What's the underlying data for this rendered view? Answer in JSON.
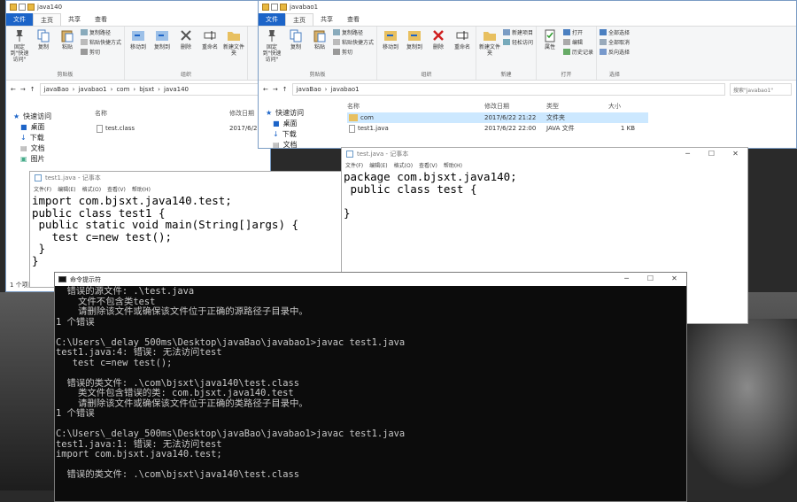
{
  "explorer1": {
    "title": "java140",
    "tabs": [
      "文件",
      "主页",
      "共享",
      "查看"
    ],
    "ribbon": {
      "pin_label": "固定到\"快速访问\"",
      "copy_label": "复制",
      "paste_label": "粘贴",
      "copy_path": "复制路径",
      "paste_shortcut": "粘贴快捷方式",
      "cut": "剪切",
      "clipboard_group": "剪贴板",
      "move_to": "移动到",
      "copy_to": "复制到",
      "delete": "删除",
      "rename": "重命名",
      "new_folder": "新建文件夹",
      "organize_group": "组织"
    },
    "path": [
      "javaBao",
      "javabao1",
      "com",
      "bjsxt",
      "java140"
    ],
    "nav": [
      "快速访问",
      "桌面",
      "下载",
      "文档",
      "图片"
    ],
    "col_name": "名称",
    "col_date": "修改日期",
    "files": [
      {
        "name": "test.class",
        "date": "2017/6/2"
      }
    ],
    "status": "1 个项目"
  },
  "explorer2": {
    "title": "javabao1",
    "tabs": [
      "文件",
      "主页",
      "共享",
      "查看"
    ],
    "ribbon": {
      "pin_label": "固定到\"快速访问\"",
      "copy_label": "复制",
      "paste_label": "粘贴",
      "copy_path": "复制路径",
      "paste_shortcut": "粘贴快捷方式",
      "cut": "剪切",
      "clipboard_group": "剪贴板",
      "move_to": "移动到",
      "copy_to": "复制到",
      "delete": "删除",
      "rename": "重命名",
      "organize_group": "组织",
      "new_item": "新建项目",
      "easy_access": "轻松访问",
      "new_folder": "新建文件夹",
      "new_group": "新建",
      "properties": "属性",
      "open": "打开",
      "edit": "编辑",
      "history": "历史记录",
      "open_group": "打开",
      "select_all": "全部选择",
      "select_none": "全部取消",
      "invert": "反向选择",
      "select_group": "选择"
    },
    "path": [
      "javaBao",
      "javabao1"
    ],
    "search_placeholder": "搜索\"javabao1\"",
    "nav": [
      "快速访问",
      "桌面",
      "下载",
      "文档",
      "图片"
    ],
    "col_name": "名称",
    "col_date": "修改日期",
    "col_type": "类型",
    "col_size": "大小",
    "files": [
      {
        "name": "com",
        "date": "2017/6/22 21:22",
        "type": "文件夹",
        "size": ""
      },
      {
        "name": "test1.java",
        "date": "2017/6/22 22:00",
        "type": "JAVA 文件",
        "size": "1 KB"
      }
    ]
  },
  "notepad1": {
    "title": "test1.java - 记事本",
    "menu": [
      "文件(F)",
      "编辑(E)",
      "格式(O)",
      "查看(V)",
      "帮助(H)"
    ],
    "content": "import com.bjsxt.java140.test;\npublic class test1 {\n public static void main(String[]args) {\n   test c=new test();\n }\n}"
  },
  "notepad2": {
    "title": "test.java - 记事本",
    "menu": [
      "文件(F)",
      "编辑(E)",
      "格式(O)",
      "查看(V)",
      "帮助(H)"
    ],
    "content": "package com.bjsxt.java140;\n public class test {\n\n}"
  },
  "cmd": {
    "title": "命令提示符",
    "content": "  错误的源文件: .\\test.java\n    文件不包含类test\n    请删除该文件或确保该文件位于正确的源路径子目录中。\n1 个错误\n\nC:\\Users\\_delay_500ms\\Desktop\\javaBao\\javabao1>javac test1.java\ntest1.java:4: 错误: 无法访问test\n   test c=new test();\n\n  错误的类文件: .\\com\\bjsxt\\java140\\test.class\n    类文件包含错误的类: com.bjsxt.java140.test\n    请删除该文件或确保该文件位于正确的类路径子目录中。\n1 个错误\n\nC:\\Users\\_delay_500ms\\Desktop\\javaBao\\javabao1>javac test1.java\ntest1.java:1: 错误: 无法访问test\nimport com.bjsxt.java140.test;\n\n  错误的类文件: .\\com\\bjsxt\\java140\\test.class"
  },
  "window_controls": {
    "minimize": "─",
    "maximize": "☐",
    "close": "✕"
  },
  "colors": {
    "accent": "#1c64c8",
    "cmd_bg": "#0c0c0c",
    "selection": "#cce8ff"
  }
}
